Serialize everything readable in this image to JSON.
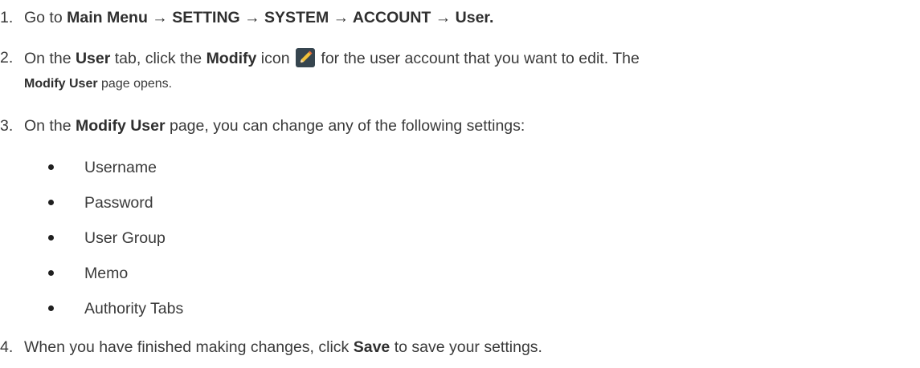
{
  "steps": [
    {
      "number": "1.",
      "line1": {
        "prefix": "Go to ",
        "path": "Main Menu → SETTING → SYSTEM → ACCOUNT → User."
      }
    },
    {
      "number": "2.",
      "line1": {
        "t1": "On the ",
        "b1": "User",
        "t2": " tab, click the ",
        "b2": "Modify",
        "t3": " icon ",
        "t4": " for the user account that you want to edit. The"
      },
      "line2": {
        "b1": "Modify User",
        "t1": " page opens."
      },
      "icon": "pencil-icon"
    },
    {
      "number": "3.",
      "line1": {
        "t1": "On the ",
        "b1": "Modify User",
        "t2": " page, you can change any of the following settings:"
      },
      "bullets": [
        "Username",
        "Password",
        "User Group",
        "Memo",
        "Authority Tabs"
      ]
    },
    {
      "number": "4.",
      "line1": {
        "t1": "When you have finished making changes, click ",
        "b1": "Save",
        "t2": " to save your settings."
      }
    }
  ]
}
